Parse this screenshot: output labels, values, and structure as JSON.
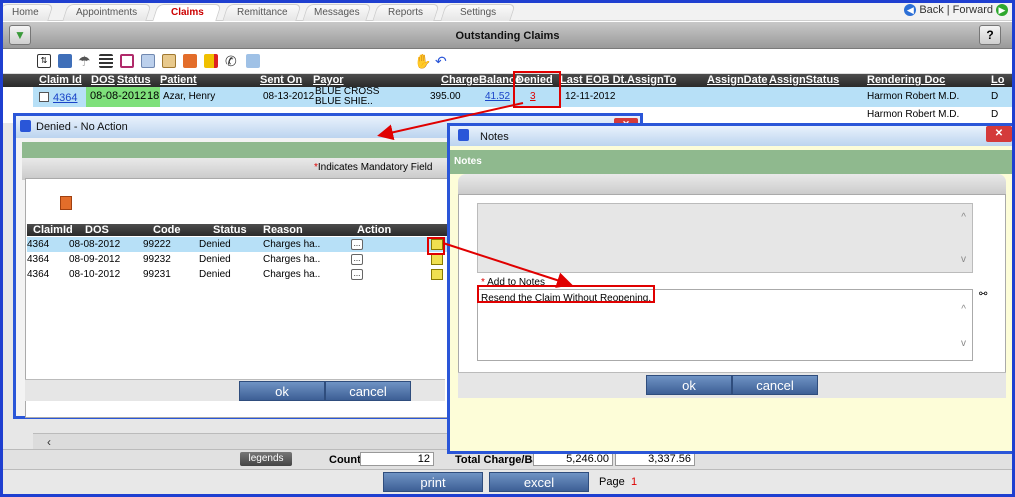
{
  "tabs": [
    "Home",
    "Appointments",
    "Claims",
    "Remittance",
    "Messages",
    "Reports",
    "Settings"
  ],
  "nav": {
    "back": "Back",
    "sep": "|",
    "forward": "Forward"
  },
  "title": "Outstanding Claims",
  "help_label": "?",
  "columns": [
    "Claim Id",
    "DOS",
    "Status",
    "Patient",
    "Sent On",
    "Payor",
    "Charge",
    "Balance",
    "Denied",
    "Last EOB Dt.",
    "AssignTo",
    "AssignDate",
    "AssignStatus",
    "Rendering Doc",
    "Lo"
  ],
  "row1": {
    "claim_id": "4364",
    "dos": "08-08-2012",
    "status": "18",
    "patient": "Azar, Henry",
    "sent_on": "08-13-2012",
    "payor": "BLUE CROSS BLUE SHIE..",
    "charge": "395.00",
    "balance": "41.52",
    "denied": "3",
    "last_eob": "12-11-2012",
    "rendering_doc": "Harmon Robert M.D.",
    "lo": "D"
  },
  "row2": {
    "rendering_doc": "Harmon Robert M.D.",
    "lo": "D"
  },
  "denied_dialog": {
    "title": "Denied - No Action",
    "mandatory": "Indicates Mandatory Field",
    "columns": [
      "ClaimId",
      "DOS",
      "Code",
      "Status",
      "Reason",
      "Action"
    ],
    "rows": [
      {
        "claim_id": "4364",
        "dos": "08-08-2012",
        "code": "99222",
        "status": "Denied",
        "reason": "Charges ha.."
      },
      {
        "claim_id": "4364",
        "dos": "08-09-2012",
        "code": "99232",
        "status": "Denied",
        "reason": "Charges ha.."
      },
      {
        "claim_id": "4364",
        "dos": "08-10-2012",
        "code": "99231",
        "status": "Denied",
        "reason": "Charges ha.."
      }
    ],
    "ellipsis": "...",
    "ok": "ok",
    "cancel": "cancel"
  },
  "notes_dialog": {
    "title": "Notes",
    "section": "Notes",
    "add_label": "Add to Notes",
    "note_text": "Resend the Claim Without Reopening.",
    "ok": "ok",
    "cancel": "cancel"
  },
  "footer": {
    "legends": "legends",
    "count_label": "Count",
    "count": "12",
    "total_label": "Total Charge/Bal",
    "total_charge": "5,246.00",
    "total_bal": "3,337.56",
    "print": "print",
    "excel": "excel",
    "page_label": "Page",
    "page": "1"
  },
  "colors": {
    "accent": "#1f3fd0",
    "highlight": "#e00000",
    "row_selected": "#b7e0f7",
    "band": "#8fb98e"
  }
}
